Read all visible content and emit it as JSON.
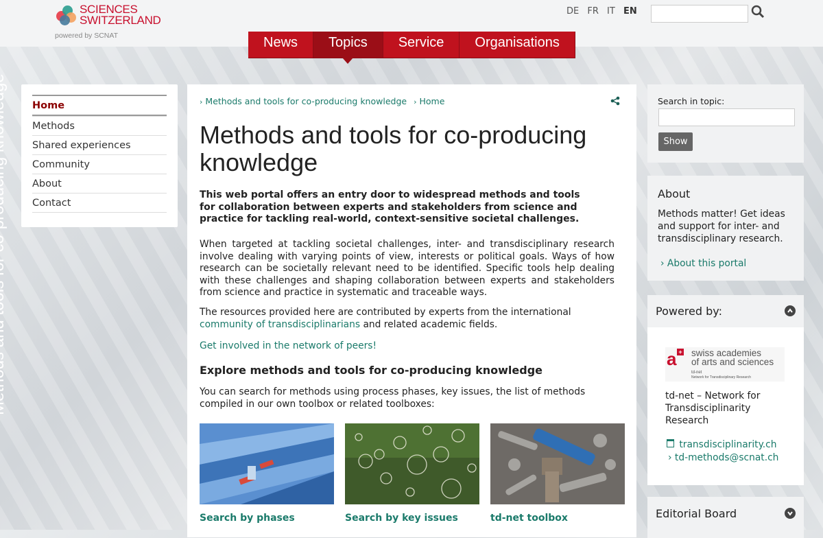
{
  "header": {
    "logo": {
      "title_line1": "SCIENCES",
      "title_line2": "SWITZERLAND",
      "subtitle": "powered by SCNAT"
    },
    "languages": [
      "DE",
      "FR",
      "IT",
      "EN"
    ],
    "active_language": "EN",
    "search_placeholder": ""
  },
  "mainnav": [
    {
      "label": "News"
    },
    {
      "label": "Topics"
    },
    {
      "label": "Service"
    },
    {
      "label": "Organisations"
    }
  ],
  "vertical_banner": "Methods and tools for co-producing knowledge",
  "leftnav": [
    "Home",
    "Methods",
    "Shared experiences",
    "Community",
    "About",
    "Contact"
  ],
  "breadcrumb": [
    "Methods and tools for co-producing knowledge",
    "Home"
  ],
  "main": {
    "title": "Methods and tools for co-producing knowledge",
    "lead": "This web portal offers an entry door to widespread methods and tools for collaboration between experts and stakeholders from science and practice for tackling real-world, context-sensitive societal challenges.",
    "p1": "When targeted at tackling societal challenges, inter- and transdisciplinary research involve dealing with varying points of view, interests or political goals. Ways of how research can be societally relevant need to be identified. Specific tools help dealing with these challenges and shaping collaboration between experts and stakeholders from science and practice in systematic and traceable ways.",
    "p2_before": "The resources provided here are contributed by experts from the international ",
    "p2_link": "community of transdisciplinarians",
    "p2_after": " and related academic fields.",
    "p3_link": "Get involved in the network of peers!",
    "h2": "Explore methods and tools for co-producing knowledge",
    "p4": "You can search for methods using process phases, key issues, the list of methods compiled in our own toolbox or related toolboxes:",
    "cards": [
      {
        "label": "Search by phases"
      },
      {
        "label": "Search by key issues"
      },
      {
        "label": "td-net toolbox"
      }
    ]
  },
  "sidebar": {
    "topic_search": {
      "label": "Search in topic:",
      "button": "Show"
    },
    "about": {
      "heading": "About",
      "text": "Methods matter! Get ideas and support for inter- and transdisciplinary research.",
      "link": "About this portal"
    },
    "powered": {
      "heading": "Powered by:",
      "logo_text_line1": "swiss academies",
      "logo_text_line2": "of arts and sciences",
      "logo_text_line3": "td-net",
      "logo_text_line4": "Network for Transdisciplinary Research",
      "name": "td-net – Network for Transdisciplinarity Research",
      "link1": "transdisciplinarity.ch",
      "link2": "td-methods@scnat.ch"
    },
    "editorial": {
      "heading": "Editorial Board"
    }
  },
  "colors": {
    "brand_red": "#c0121e",
    "link_teal": "#1a7a6a",
    "active_nav": "#8b0000"
  }
}
